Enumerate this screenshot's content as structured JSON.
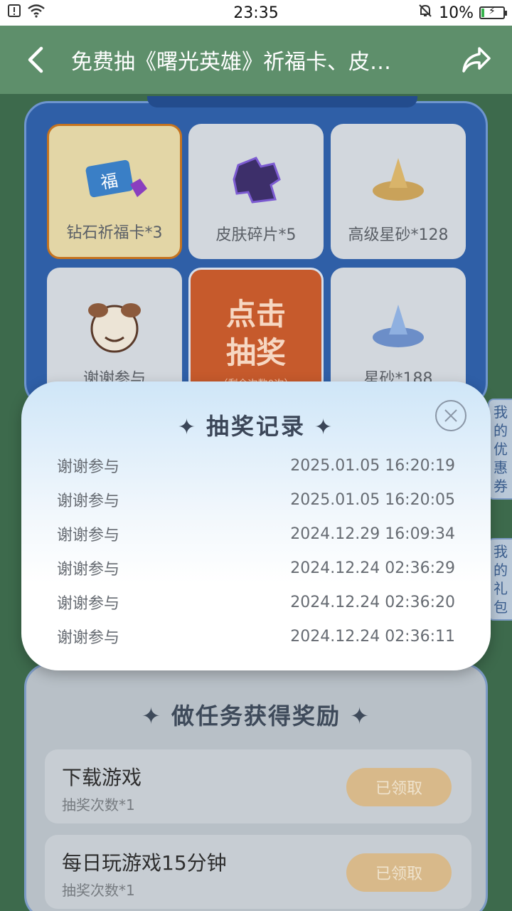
{
  "status_bar": {
    "time": "23:35",
    "battery_pct": "10%",
    "battery_level": 0.1,
    "icons": [
      "sim-alert-icon",
      "wifi-icon",
      "mute-bell-icon",
      "battery-charging-icon"
    ]
  },
  "header": {
    "title": "免费抽《曙光英雄》祈福卡、皮…",
    "back_icon": "chevron-left-icon",
    "share_icon": "share-arrow-icon"
  },
  "lottery": {
    "prizes": [
      {
        "label": "钻石祈福卡*3",
        "icon": "blessing-card-icon"
      },
      {
        "label": "皮肤碎片*5",
        "icon": "puzzle-piece-icon"
      },
      {
        "label": "高级星砂*128",
        "icon": "gold-sand-icon"
      },
      {
        "label": "谢谢参与",
        "icon": "mascot-icon"
      },
      {
        "label": "星砂*188",
        "icon": "blue-sand-icon"
      }
    ],
    "draw_button": {
      "line1": "点击",
      "line2": "抽奖",
      "sub": "（剩余次数0次）"
    }
  },
  "side_tabs": {
    "coupons": "我的优惠券",
    "gifts": "我的礼包"
  },
  "tasks": {
    "title": "做任务获得奖励",
    "items": [
      {
        "name": "下载游戏",
        "reward": "抽奖次数*1",
        "button": "已领取"
      },
      {
        "name": "每日玩游戏15分钟",
        "reward": "抽奖次数*1",
        "button": "已领取"
      }
    ]
  },
  "modal": {
    "title": "抽奖记录",
    "close_icon": "close-circle-icon",
    "records": [
      {
        "result": "谢谢参与",
        "time": "2025.01.05 16:20:19"
      },
      {
        "result": "谢谢参与",
        "time": "2025.01.05 16:20:05"
      },
      {
        "result": "谢谢参与",
        "time": "2024.12.29 16:09:34"
      },
      {
        "result": "谢谢参与",
        "time": "2024.12.24 02:36:29"
      },
      {
        "result": "谢谢参与",
        "time": "2024.12.24 02:36:20"
      },
      {
        "result": "谢谢参与",
        "time": "2024.12.24 02:36:11"
      }
    ]
  },
  "colors": {
    "header_bg": "#5e8f6b",
    "panel_blue": "#2f5fa7",
    "draw_orange": "#c65a2c",
    "claimed_btn": "#d8b98a"
  }
}
